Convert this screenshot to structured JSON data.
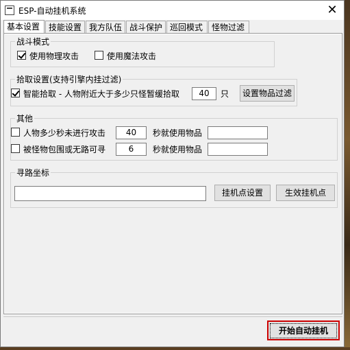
{
  "window": {
    "title": "ESP-自动挂机系统",
    "close_glyph": "✕"
  },
  "tabs": [
    {
      "label": "基本设置",
      "active": true
    },
    {
      "label": "技能设置",
      "active": false
    },
    {
      "label": "我方队伍",
      "active": false
    },
    {
      "label": "战斗保护",
      "active": false
    },
    {
      "label": "巡回模式",
      "active": false
    },
    {
      "label": "怪物过滤",
      "active": false
    }
  ],
  "combat_mode": {
    "title": "战斗模式",
    "physical": {
      "label": "使用物理攻击",
      "checked": true
    },
    "magic": {
      "label": "使用魔法攻击",
      "checked": false
    }
  },
  "pickup": {
    "title": "拾取设置(支持引擎内挂过滤)",
    "smart": {
      "label": "智能拾取 - 人物附近大于多少只怪暂缓拾取",
      "checked": true
    },
    "count_value": "40",
    "unit": "只",
    "filter_button": "设置物品过滤"
  },
  "other": {
    "title": "其他",
    "row1": {
      "label": "人物多少秒未进行攻击",
      "checked": false,
      "value": "40",
      "suffix": "秒就使用物品",
      "item": ""
    },
    "row2": {
      "label": "被怪物包围或无路可寻",
      "checked": false,
      "value": "6",
      "suffix": "秒就使用物品",
      "item": ""
    }
  },
  "pathing": {
    "title": "寻路坐标",
    "coord_value": "",
    "set_button": "挂机点设置",
    "apply_button": "生效挂机点"
  },
  "footer": {
    "start_button": "开始自动挂机"
  }
}
